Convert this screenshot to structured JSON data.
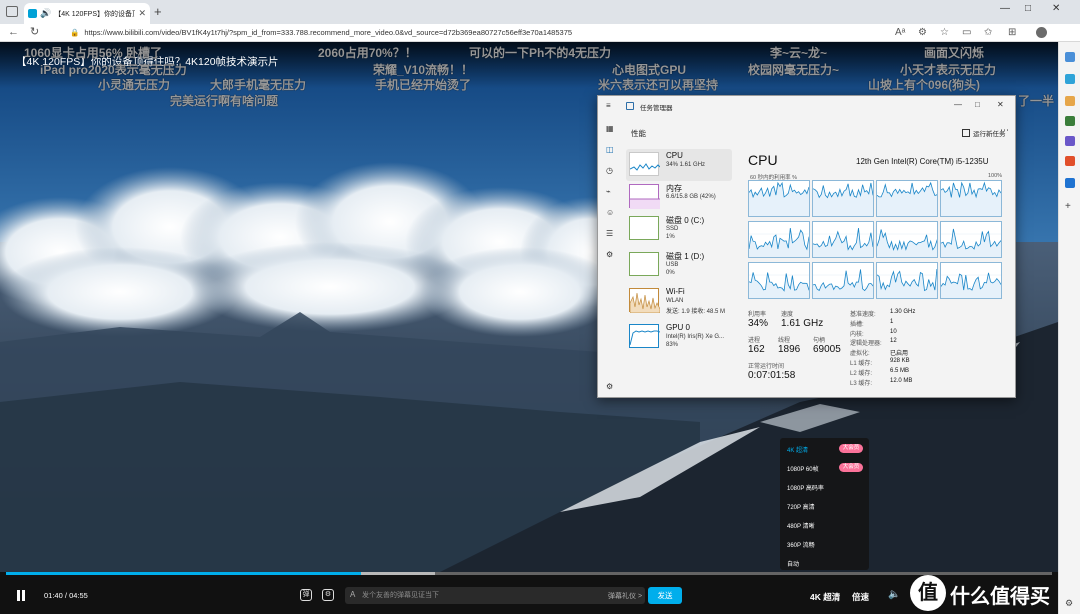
{
  "browser": {
    "tab_title": "【4K 120FPS】你的设备顶得...",
    "url": "https://www.bilibili.com/video/BV1fK4y1t7hj/?spm_id_from=333.788.recommend_more_video.0&vd_source=d72b369ea80727c56eff3e70a1485375",
    "window_controls": [
      "—",
      "□",
      "✕"
    ]
  },
  "video": {
    "title": "【4K 120FPS】你的设备顶得住吗？4K120帧技术演示片"
  },
  "danmaku": [
    "1060显卡占用56%  卧槽了",
    "iPad pro2020表示毫无压力",
    "小灵通无压力",
    "大郎手机毫无压力",
    "完美运行啊有啥问题",
    "2060占用70%？！",
    "荣耀_V10流畅！！",
    "手机已经开始烫了",
    "可以的一下Ph不的4无压力",
    "心电图式GPU",
    "米六表示还可以再坚持",
    "李~云~龙~",
    "校园网毫无压力~",
    "画面又闪烁",
    "小天才表示无压力",
    "山坡上有个096(狗头)",
    "了一半"
  ],
  "task_manager": {
    "title": "任务管理器",
    "section": "性能",
    "run_task": "运行新任务",
    "devices": [
      {
        "name": "CPU",
        "line1": "34% 1.61 GHz",
        "line2": ""
      },
      {
        "name": "内存",
        "line1": "6.6/15.8 GB (42%)",
        "line2": ""
      },
      {
        "name": "磁盘 0 (C:)",
        "line1": "SSD",
        "line2": "1%"
      },
      {
        "name": "磁盘 1 (D:)",
        "line1": "USB",
        "line2": "0%"
      },
      {
        "name": "Wi-Fi",
        "line1": "WLAN",
        "line2": "发送: 1.9 接收: 48.5 M"
      },
      {
        "name": "GPU 0",
        "line1": "Intel(R) Iris(R) Xe G...",
        "line2": "83%"
      }
    ],
    "cpu_heading": "CPU",
    "cpu_model": "12th Gen Intel(R) Core(TM) i5-1235U",
    "util_label": "60 秒内的利用率 %",
    "util_max": "100%",
    "stats": {
      "util_label": "利用率",
      "util": "34%",
      "speed_label": "速度",
      "speed": "1.61 GHz",
      "proc_label": "进程",
      "proc": "162",
      "thread_label": "线程",
      "thread": "1896",
      "handle_label": "句柄",
      "handle": "69005",
      "uptime_label": "正常运行时间",
      "uptime": "0:07:01:58"
    },
    "specs": [
      {
        "k": "基准速度:",
        "v": "1.30 GHz"
      },
      {
        "k": "插槽:",
        "v": "1"
      },
      {
        "k": "内核:",
        "v": "10"
      },
      {
        "k": "逻辑处理器:",
        "v": "12"
      },
      {
        "k": "虚拟化:",
        "v": "已启用"
      },
      {
        "k": "L1 缓存:",
        "v": "928 KB"
      },
      {
        "k": "L2 缓存:",
        "v": "6.5 MB"
      },
      {
        "k": "L3 缓存:",
        "v": "12.0 MB"
      }
    ]
  },
  "quality_menu": {
    "items": [
      "4K 超清",
      "1080P 60帧",
      "1080P 高码率",
      "720P 高清",
      "480P 清晰",
      "360P 流畅",
      "自动"
    ],
    "badge": "大会员"
  },
  "player": {
    "current_time": "01:40",
    "separator": "/",
    "duration": "04:55",
    "progress": 0.339,
    "buffered": 0.41,
    "danmaku_placeholder": "发个友善的弹幕见证当下",
    "danmaku_etiquette": "弹幕礼仪 >",
    "send": "发送",
    "quality": "4K 超清",
    "speed": "倍速"
  },
  "watermark": "什么值得买",
  "colors": {
    "accent": "#00aeec",
    "vip_pink": "#fb7299",
    "graph_line": "#1a86c8"
  }
}
